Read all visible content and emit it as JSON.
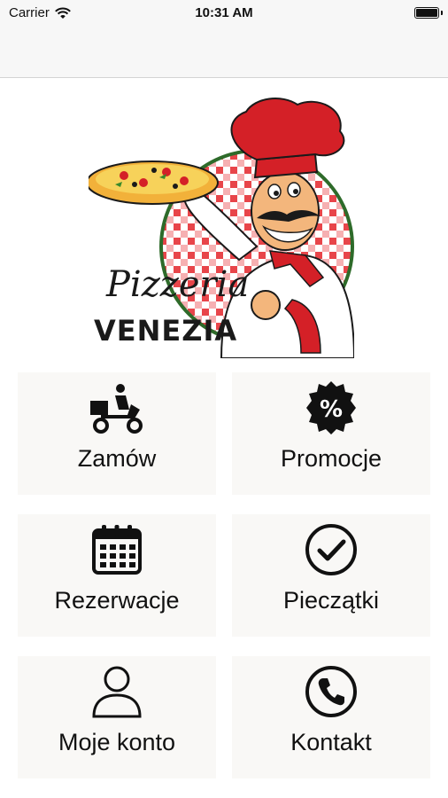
{
  "status_bar": {
    "carrier": "Carrier",
    "time": "10:31 AM",
    "icons": [
      "wifi-icon",
      "battery-icon"
    ]
  },
  "logo": {
    "script_text": "Pizzeria",
    "brand_text": "VENEZIA"
  },
  "menu": {
    "tiles": [
      {
        "label": "Zamów",
        "icon": "delivery-scooter-icon"
      },
      {
        "label": "Promocje",
        "icon": "percent-badge-icon"
      },
      {
        "label": "Rezerwacje",
        "icon": "calendar-icon"
      },
      {
        "label": "Pieczątki",
        "icon": "checkmark-circle-icon"
      },
      {
        "label": "Moje konto",
        "icon": "user-icon"
      },
      {
        "label": "Kontakt",
        "icon": "phone-icon"
      }
    ]
  },
  "colors": {
    "tile_background": "#f9f8f6",
    "chef_red": "#d42027",
    "status_background": "#f7f7f7"
  }
}
